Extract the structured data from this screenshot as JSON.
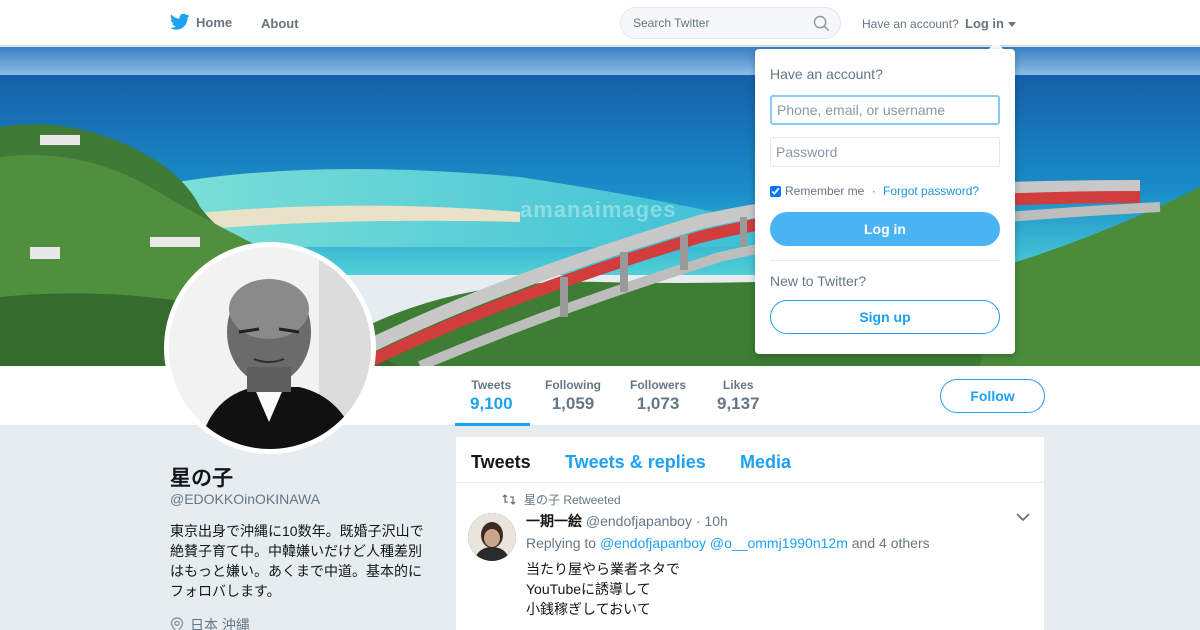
{
  "topbar": {
    "home_label": "Home",
    "about_label": "About",
    "search_placeholder": "Search Twitter",
    "have_account": "Have an account?",
    "login_label": "Log in"
  },
  "header": {
    "watermark": "amanaimages"
  },
  "profile": {
    "name": "星の子",
    "handle": "@EDOKKOinOKINAWA",
    "bio": "東京出身で沖縄に10数年。既婚子沢山で絶賛子育て中。中韓嫌いだけど人種差別はもっと嫌い。あくまで中道。基本的にフォロバします。",
    "location": "日本 沖縄"
  },
  "stats": [
    {
      "label": "Tweets",
      "value": "9,100"
    },
    {
      "label": "Following",
      "value": "1,059"
    },
    {
      "label": "Followers",
      "value": "1,073"
    },
    {
      "label": "Likes",
      "value": "9,137"
    }
  ],
  "follow_label": "Follow",
  "timeline": {
    "tabs": [
      "Tweets",
      "Tweets & replies",
      "Media"
    ],
    "tweet": {
      "retweeted_by": "星の子 Retweeted",
      "author_name": "一期一絵",
      "author_handle": "@endofjapanboy",
      "time": "· 10h",
      "replying_prefix": "Replying to",
      "mention1": "@endofjapanboy",
      "mention2": "@o__ommj1990n12m",
      "replying_suffix": "and 4 others",
      "lines": [
        "当たり屋やら業者ネタで",
        "YouTubeに誘導して",
        "小銭稼ぎしておいて"
      ]
    }
  },
  "login_dropdown": {
    "title": "Have an account?",
    "username_placeholder": "Phone, email, or username",
    "password_placeholder": "Password",
    "remember_label": "Remember me",
    "separator": " · ",
    "forgot_label": "Forgot password?",
    "login_button": "Log in",
    "new_label": "New to Twitter?",
    "signup_button": "Sign up"
  },
  "colors": {
    "brand": "#1da1f2",
    "login_button": "#4ab3f4"
  }
}
